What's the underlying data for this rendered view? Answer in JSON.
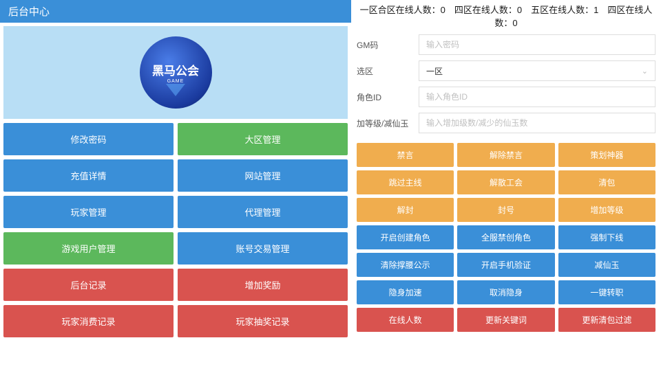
{
  "title": "后台中心",
  "logo": {
    "main": "黑马公会",
    "sub": "GAME"
  },
  "menu": [
    {
      "label": "修改密码",
      "color": "c-blue"
    },
    {
      "label": "大区管理",
      "color": "c-green"
    },
    {
      "label": "充值详情",
      "color": "c-blue"
    },
    {
      "label": "网站管理",
      "color": "c-blue"
    },
    {
      "label": "玩家管理",
      "color": "c-blue"
    },
    {
      "label": "代理管理",
      "color": "c-blue"
    },
    {
      "label": "游戏用户管理",
      "color": "c-green"
    },
    {
      "label": "账号交易管理",
      "color": "c-blue"
    },
    {
      "label": "后台记录",
      "color": "c-red"
    },
    {
      "label": "增加奖励",
      "color": "c-red"
    },
    {
      "label": "玩家消费记录",
      "color": "c-red"
    },
    {
      "label": "玩家抽奖记录",
      "color": "c-red"
    }
  ],
  "status": "一区合区在线人数：0　四区在线人数：0　五区在线人数：1　四区在线人数：0",
  "form": {
    "gm_label": "GM码",
    "gm_placeholder": "输入密码",
    "zone_label": "选区",
    "zone_value": "一区",
    "role_label": "角色ID",
    "role_placeholder": "输入角色ID",
    "level_label": "加等级/减仙玉",
    "level_placeholder": "输入增加级数/减少的仙玉数"
  },
  "actions": [
    {
      "label": "禁言",
      "color": "a-orange"
    },
    {
      "label": "解除禁言",
      "color": "a-orange"
    },
    {
      "label": "策划神器",
      "color": "a-orange"
    },
    {
      "label": "跳过主线",
      "color": "a-orange"
    },
    {
      "label": "解散工会",
      "color": "a-orange"
    },
    {
      "label": "清包",
      "color": "a-orange"
    },
    {
      "label": "解封",
      "color": "a-orange"
    },
    {
      "label": "封号",
      "color": "a-orange"
    },
    {
      "label": "增加等级",
      "color": "a-orange"
    },
    {
      "label": "开启创建角色",
      "color": "a-blue"
    },
    {
      "label": "全服禁创角色",
      "color": "a-blue"
    },
    {
      "label": "强制下线",
      "color": "a-blue"
    },
    {
      "label": "清除撑腰公示",
      "color": "a-blue"
    },
    {
      "label": "开启手机验证",
      "color": "a-blue"
    },
    {
      "label": "减仙玉",
      "color": "a-blue"
    },
    {
      "label": "隐身加速",
      "color": "a-blue"
    },
    {
      "label": "取消隐身",
      "color": "a-blue"
    },
    {
      "label": "一键转职",
      "color": "a-blue"
    },
    {
      "label": "在线人数",
      "color": "a-red"
    },
    {
      "label": "更新关键词",
      "color": "a-red"
    },
    {
      "label": "更新清包过滤",
      "color": "a-red"
    }
  ]
}
